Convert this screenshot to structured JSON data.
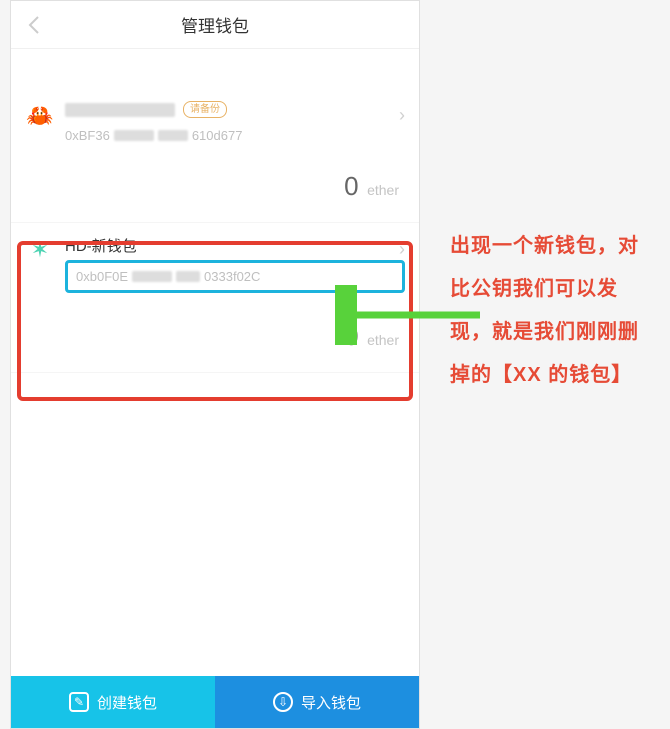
{
  "header": {
    "title": "管理钱包"
  },
  "wallets": [
    {
      "addr_prefix": "0xBF36",
      "addr_suffix": "610d677",
      "badge": "请备份",
      "balance": "0",
      "unit": "ether"
    },
    {
      "name": "HD-新钱包",
      "addr_prefix": "0xb0F0E",
      "addr_suffix": "0333f02C",
      "balance": "0",
      "unit": "ether"
    }
  ],
  "bottom": {
    "create": "创建钱包",
    "import": "导入钱包"
  },
  "annotation": "出现一个新钱包，对比公钥我们可以发现，就是我们刚刚删掉的【XX 的钱包】"
}
